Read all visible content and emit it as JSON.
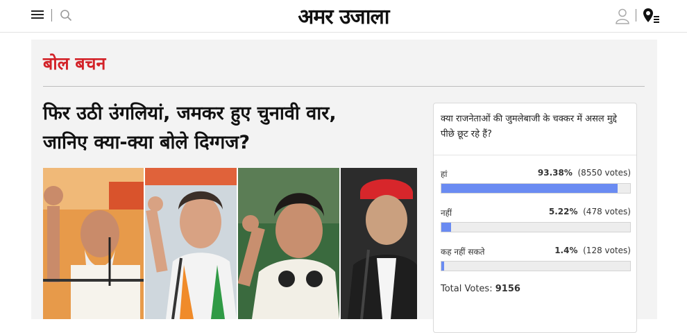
{
  "header": {
    "logo_text": "अमर उजाला",
    "icons": [
      "menu-icon",
      "search-icon",
      "user-icon",
      "location-list-icon"
    ]
  },
  "section": {
    "title": "बोल बचन"
  },
  "article": {
    "headline_line1": "फिर उठी उंगलियां, जमकर हुए चुनावी वार,",
    "headline_line2": "जानिए क्या-क्या बोले दिग्गज?"
  },
  "poll": {
    "question": "क्या राजनेताओं की जुमलेबाजी के चक्कर में असल मुद्दे पीछे छूट रहे हैं?",
    "options": [
      {
        "label": "हां",
        "percent": "93.38%",
        "votes": "(8550 votes)",
        "fraction": 0.9338
      },
      {
        "label": "नहीं",
        "percent": "5.22%",
        "votes": "(478 votes)",
        "fraction": 0.0522
      },
      {
        "label": "कह नहीं सकते",
        "percent": "1.4%",
        "votes": "(128 votes)",
        "fraction": 0.014
      }
    ],
    "total_label": "Total Votes:",
    "total_value": "9156"
  },
  "colors": {
    "accent_red": "#d32228",
    "bar_blue": "#6a8bf2",
    "panel_bg": "#f3f3f3"
  }
}
